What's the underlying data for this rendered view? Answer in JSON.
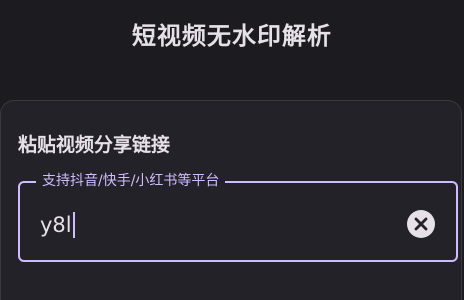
{
  "header": {
    "title": "短视频无水印解析"
  },
  "share_card": {
    "heading": "粘贴视频分享链接",
    "link_field": {
      "label": "支持抖音/快手/小红书等平台",
      "value": "y8l",
      "clear_icon": "clear-circle-icon"
    }
  },
  "colors": {
    "background": "#1c1b20",
    "card": "#232228",
    "accent": "#cdbdff",
    "text": "#e6e1e9"
  }
}
